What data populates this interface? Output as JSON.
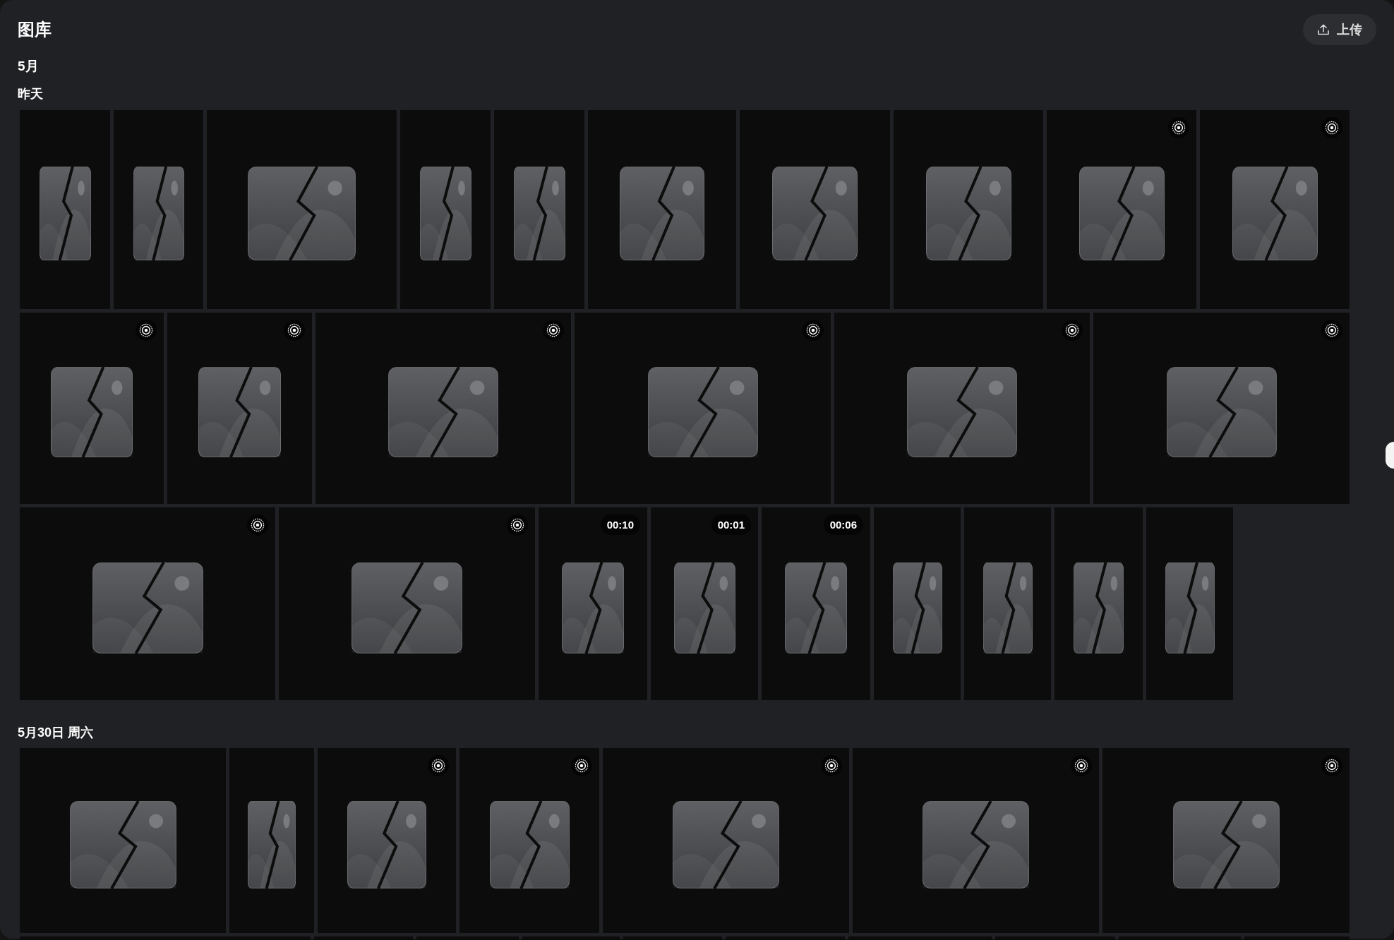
{
  "header": {
    "title": "图库",
    "upload_button": "上传"
  },
  "month": "5月",
  "groups": [
    {
      "date": "昨天",
      "rows": [
        {
          "tiles": [
            {
              "kind": "photo",
              "cut_off": false
            },
            {
              "kind": "photo",
              "cut_off": false
            },
            {
              "kind": "photo",
              "cut_off": false
            },
            {
              "kind": "photo",
              "cut_off": false
            },
            {
              "kind": "photo",
              "cut_off": false
            },
            {
              "kind": "photo",
              "cut_off": false
            },
            {
              "kind": "photo",
              "cut_off": false
            },
            {
              "kind": "photo",
              "cut_off": false
            },
            {
              "kind": "live",
              "cut_off": false
            },
            {
              "kind": "live",
              "cut_off": false
            }
          ]
        },
        {
          "tiles": [
            {
              "kind": "live",
              "cut_off": false
            },
            {
              "kind": "live",
              "cut_off": false
            },
            {
              "kind": "live",
              "cut_off": false
            },
            {
              "kind": "live",
              "cut_off": false
            },
            {
              "kind": "live",
              "cut_off": false
            },
            {
              "kind": "live",
              "cut_off": false
            }
          ]
        },
        {
          "tiles": [
            {
              "kind": "live",
              "cut_off": false
            },
            {
              "kind": "live",
              "cut_off": false
            },
            {
              "kind": "video",
              "duration": "00:10",
              "cut_off": false
            },
            {
              "kind": "video",
              "duration": "00:01",
              "cut_off": false
            },
            {
              "kind": "video",
              "duration": "00:06",
              "cut_off": false
            },
            {
              "kind": "photo",
              "cut_off": false
            },
            {
              "kind": "photo",
              "cut_off": false
            },
            {
              "kind": "photo",
              "cut_off": false
            },
            {
              "kind": "photo",
              "cut_off": false
            }
          ]
        }
      ]
    },
    {
      "date": "5月30日 周六",
      "rows": [
        {
          "tiles": [
            {
              "kind": "photo",
              "cut_off": false
            },
            {
              "kind": "photo",
              "cut_off": false
            },
            {
              "kind": "live",
              "cut_off": false
            },
            {
              "kind": "live",
              "cut_off": false
            },
            {
              "kind": "live",
              "cut_off": false
            },
            {
              "kind": "live",
              "cut_off": false
            },
            {
              "kind": "live",
              "cut_off": false
            }
          ]
        },
        {
          "tiles": [
            {
              "cut_off": true
            },
            {
              "cut_off": true
            },
            {
              "cut_off": true
            },
            {
              "cut_off": true
            },
            {
              "cut_off": true
            },
            {
              "cut_off": true
            },
            {
              "cut_off": true
            },
            {
              "cut_off": true
            },
            {
              "cut_off": true
            },
            {
              "cut_off": true
            }
          ]
        }
      ]
    }
  ]
}
